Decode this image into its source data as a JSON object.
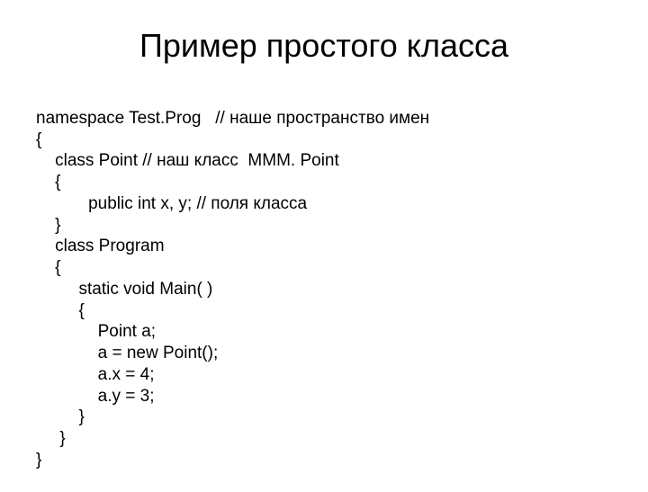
{
  "title": "Пример простого класса",
  "code": {
    "l1": "namespace Test.Prog   // наше пространство имен",
    "l2": "{",
    "l3": "    class Point // наш класс  MMM. Point",
    "l4": "    {",
    "l5": "           public int x, y; // поля класса",
    "l6": "    }",
    "l7": "    class Program",
    "l8": "    {",
    "l9": "         static void Main( )",
    "l10": "         {",
    "l11": "             Point a;",
    "l12": "             a = new Point();",
    "l13": "             a.x = 4;",
    "l14": "             a.y = 3;",
    "l15": "         }",
    "l16": "     }",
    "l17": "}"
  }
}
